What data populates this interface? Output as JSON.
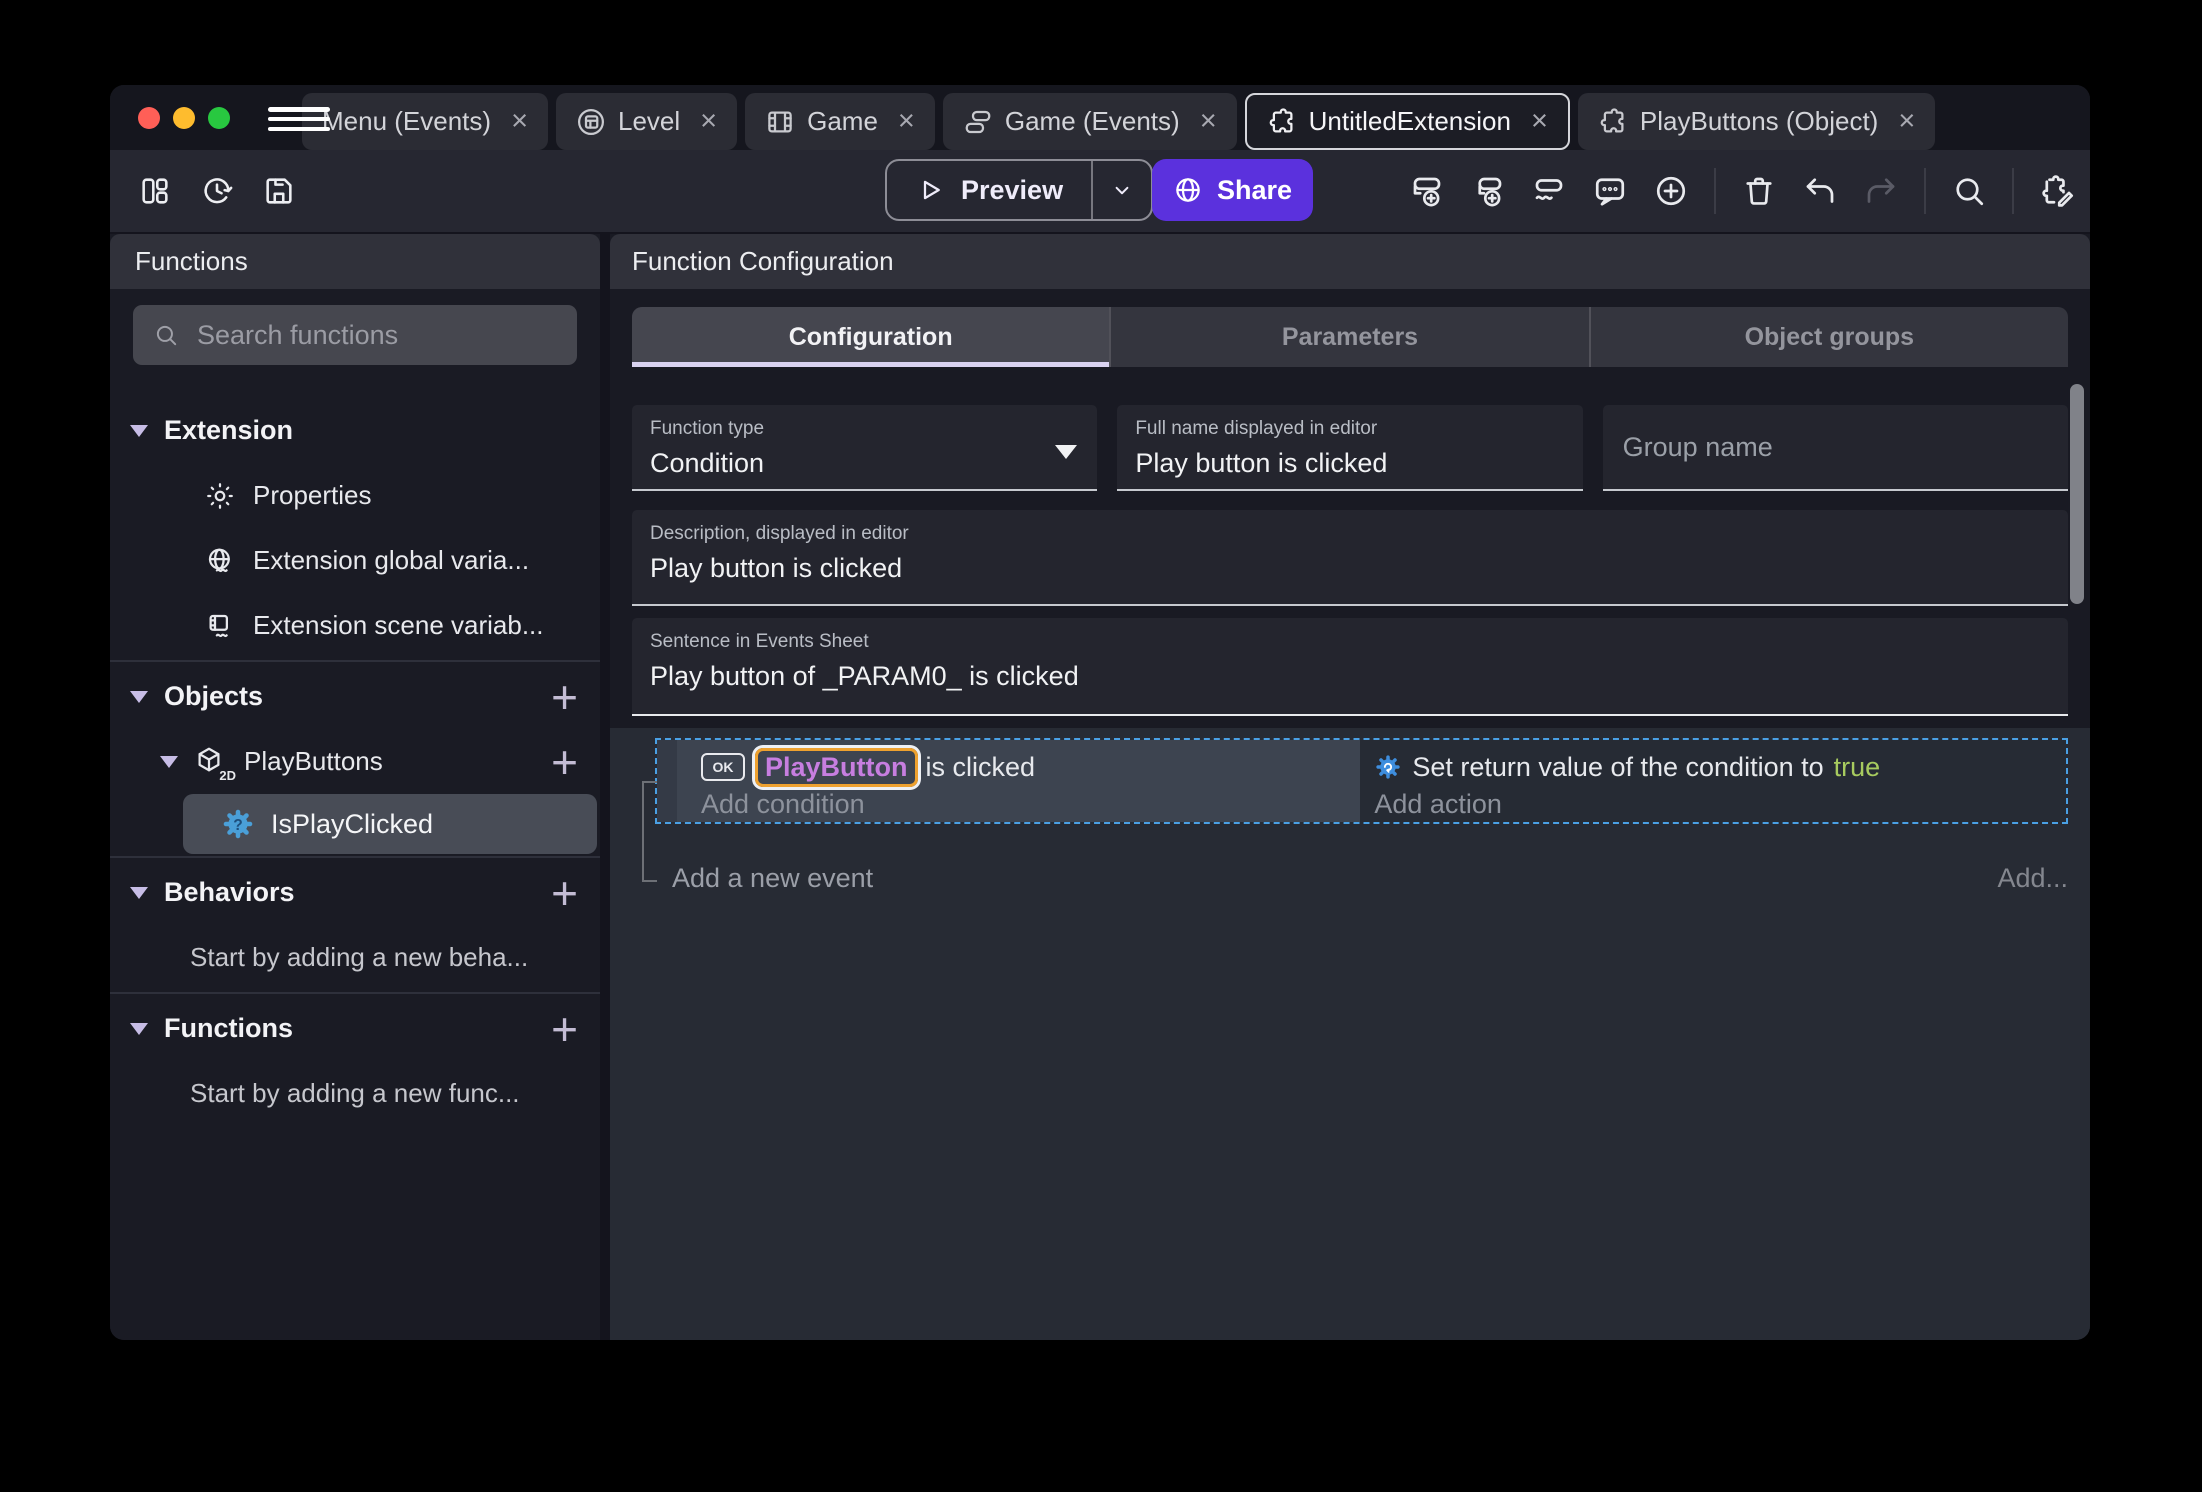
{
  "titlebar": {
    "tabs": [
      {
        "label": "Menu (Events)"
      },
      {
        "label": "Level"
      },
      {
        "label": "Game"
      },
      {
        "label": "Game (Events)"
      },
      {
        "label": "UntitledExtension"
      },
      {
        "label": "PlayButtons (Object)"
      }
    ],
    "close_symbol": "×"
  },
  "toolbar": {
    "preview_label": "Preview",
    "share_label": "Share"
  },
  "sidebar": {
    "title": "Functions",
    "search_placeholder": "Search functions",
    "extension_header": "Extension",
    "extension_items": [
      {
        "label": "Properties"
      },
      {
        "label": "Extension global varia..."
      },
      {
        "label": "Extension scene variab..."
      }
    ],
    "objects_header": "Objects",
    "object_name": "PlayButtons",
    "object_badge": "2D",
    "object_function": "IsPlayClicked",
    "behaviors_header": "Behaviors",
    "behaviors_empty": "Start by adding a new beha...",
    "functions_header": "Functions",
    "functions_empty": "Start by adding a new func..."
  },
  "main": {
    "title": "Function Configuration",
    "tabs": [
      {
        "label": "Configuration"
      },
      {
        "label": "Parameters"
      },
      {
        "label": "Object groups"
      }
    ],
    "fields": {
      "function_type": {
        "label": "Function type",
        "value": "Condition"
      },
      "full_name": {
        "label": "Full name displayed in editor",
        "value": "Play button is clicked"
      },
      "group_name": {
        "placeholder": "Group name"
      },
      "description": {
        "label": "Description, displayed in editor",
        "value": "Play button is clicked"
      },
      "sentence": {
        "label": "Sentence in Events Sheet",
        "value": "Play button of _PARAM0_ is clicked"
      }
    },
    "events": {
      "condition_object_badge": "OK",
      "condition_object": "PlayButton",
      "condition_text": "is clicked",
      "add_condition": "Add condition",
      "action_text": "Set return value of the condition to",
      "action_value": "true",
      "add_action": "Add action",
      "add_event": "Add a new event",
      "add_more": "Add..."
    }
  },
  "colors": {
    "accent_purple": "#5b31dd",
    "selection_blue": "#4aa0e4",
    "object_purple": "#c77ee0",
    "highlight_orange": "#eea12f",
    "true_green": "#a7cb5f",
    "traffic_red": "#ff5f57",
    "traffic_yellow": "#febc2e",
    "traffic_green": "#28c840"
  }
}
